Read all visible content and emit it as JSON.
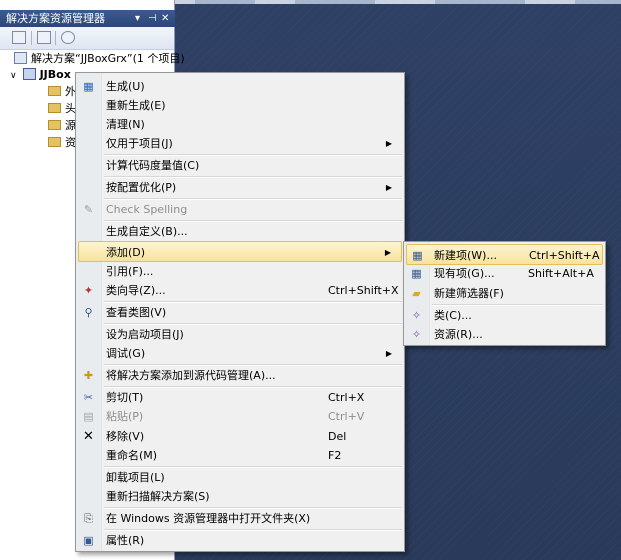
{
  "panel": {
    "title": "解决方案资源管理器",
    "controls": [
      "▾",
      "⊣",
      "✕"
    ],
    "solution_label": "解决方案“JJBoxGrx”(1 个项目)",
    "project_label": "JJBox",
    "folders": [
      "外",
      "头",
      "源",
      "资"
    ]
  },
  "context_menu": {
    "items": [
      {
        "label": "生成(U)",
        "shortcut": "",
        "icon": "build-icon"
      },
      {
        "label": "重新生成(E)",
        "shortcut": ""
      },
      {
        "label": "清理(N)",
        "shortcut": ""
      },
      {
        "label": "仅用于项目(J)",
        "submenu": true
      },
      {
        "label": "计算代码度量值(C)"
      },
      {
        "label": "按配置优化(P)",
        "submenu": true
      },
      {
        "label": "Check Spelling",
        "disabled": true,
        "icon": "spellcheck-icon"
      },
      {
        "label": "生成自定义(B)..."
      },
      {
        "label": "添加(D)",
        "submenu": true,
        "highlighted": true
      },
      {
        "label": "引用(F)..."
      },
      {
        "label": "类向导(Z)...",
        "shortcut": "Ctrl+Shift+X",
        "icon": "class-wizard-icon"
      },
      {
        "label": "查看类图(V)",
        "icon": "class-diagram-icon"
      },
      {
        "label": "设为启动项目(J)"
      },
      {
        "label": "调试(G)",
        "submenu": true
      },
      {
        "label": "将解决方案添加到源代码管理(A)...",
        "icon": "source-control-icon"
      },
      {
        "label": "剪切(T)",
        "shortcut": "Ctrl+X",
        "icon": "cut-icon"
      },
      {
        "label": "粘贴(P)",
        "shortcut": "Ctrl+V",
        "disabled": true,
        "icon": "paste-icon"
      },
      {
        "label": "移除(V)",
        "shortcut": "Del",
        "icon": "remove-icon"
      },
      {
        "label": "重命名(M)",
        "shortcut": "F2"
      },
      {
        "label": "卸载项目(L)"
      },
      {
        "label": "重新扫描解决方案(S)"
      },
      {
        "label": "在 Windows 资源管理器中打开文件夹(X)",
        "icon": "open-folder-icon"
      },
      {
        "label": "属性(R)",
        "icon": "properties-icon"
      }
    ]
  },
  "add_submenu": {
    "items": [
      {
        "label": "新建项(W)...",
        "shortcut": "Ctrl+Shift+A",
        "icon": "new-item-icon",
        "highlighted": true
      },
      {
        "label": "现有项(G)...",
        "shortcut": "Shift+Alt+A",
        "icon": "existing-item-icon"
      },
      {
        "label": "新建筛选器(F)",
        "icon": "filter-folder-icon"
      },
      {
        "label": "类(C)...",
        "icon": "class-icon"
      },
      {
        "label": "资源(R)...",
        "icon": "resource-icon"
      }
    ]
  },
  "colors": {
    "editor_bg": "#2b3c59",
    "menu_bg": "#f0f0f0",
    "highlight": "#f7e39c",
    "panel_title": "#3b5a8f"
  }
}
